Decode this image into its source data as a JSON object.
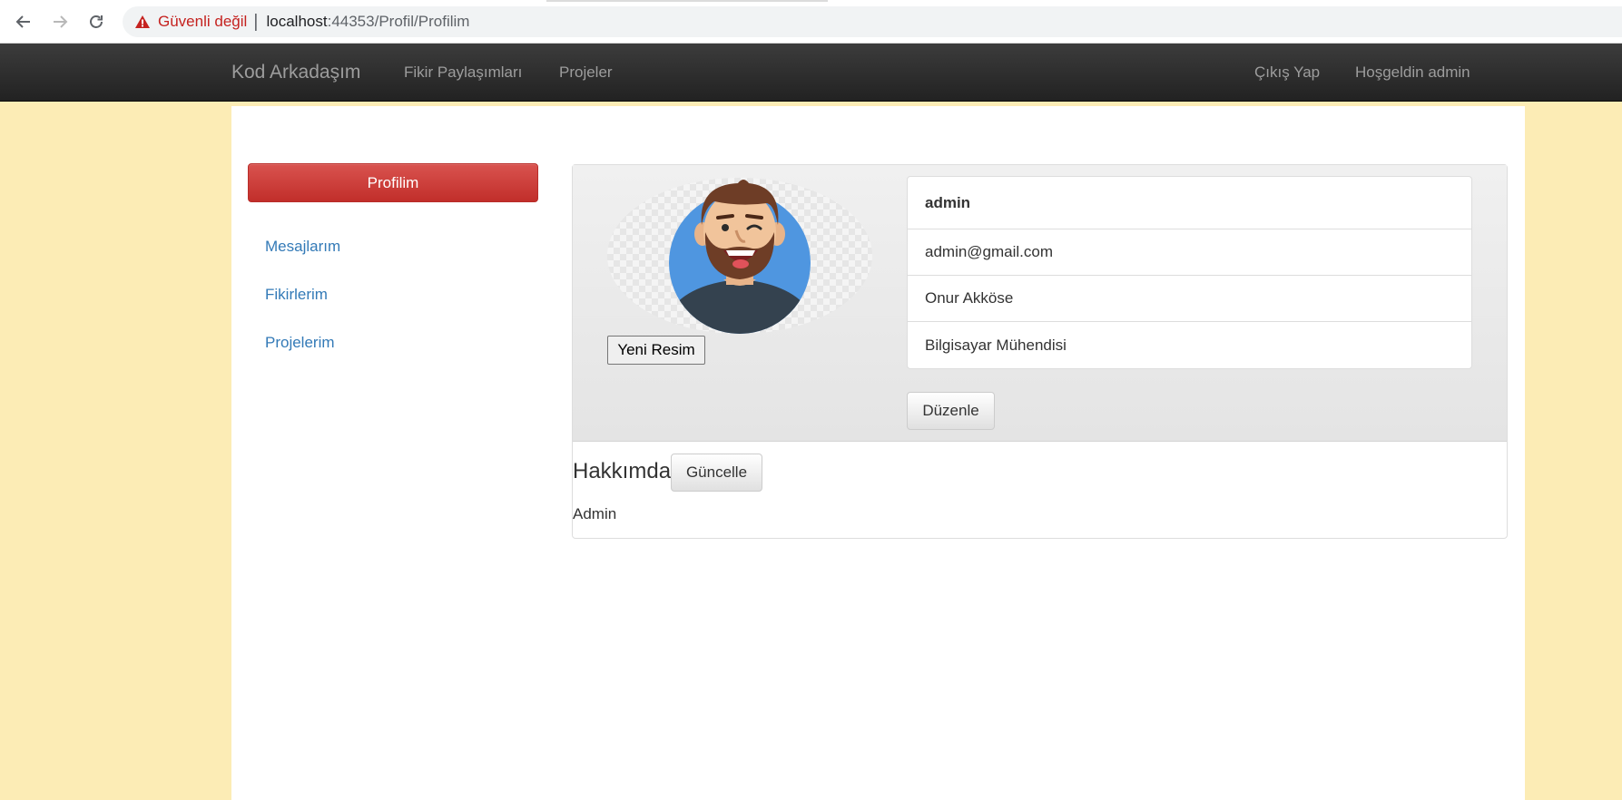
{
  "browser": {
    "security_label": "Güvenli değil",
    "url_host": "localhost",
    "url_path": ":44353/Profil/Profilim"
  },
  "navbar": {
    "brand": "Kod Arkadaşım",
    "links": [
      "Fikir Paylaşımları",
      "Projeler"
    ],
    "right_links": [
      "Çıkış Yap",
      "Hoşgeldin admin"
    ]
  },
  "sidebar": {
    "active_button": "Profilim",
    "items": [
      "Mesajlarım",
      "Fikirlerim",
      "Projelerim"
    ]
  },
  "profile": {
    "new_image_button": "Yeni Resim",
    "username": "admin",
    "email": "admin@gmail.com",
    "full_name": "Onur Akköse",
    "title": "Bilgisayar Mühendisi",
    "edit_button": "Düzenle"
  },
  "about": {
    "heading": "Hakkımda",
    "update_button": "Güncelle",
    "text": "Admin"
  },
  "colors": {
    "page_background": "#fcecb5",
    "navbar": "#222222",
    "primary_danger": "#d9534f",
    "link": "#337ab7"
  }
}
